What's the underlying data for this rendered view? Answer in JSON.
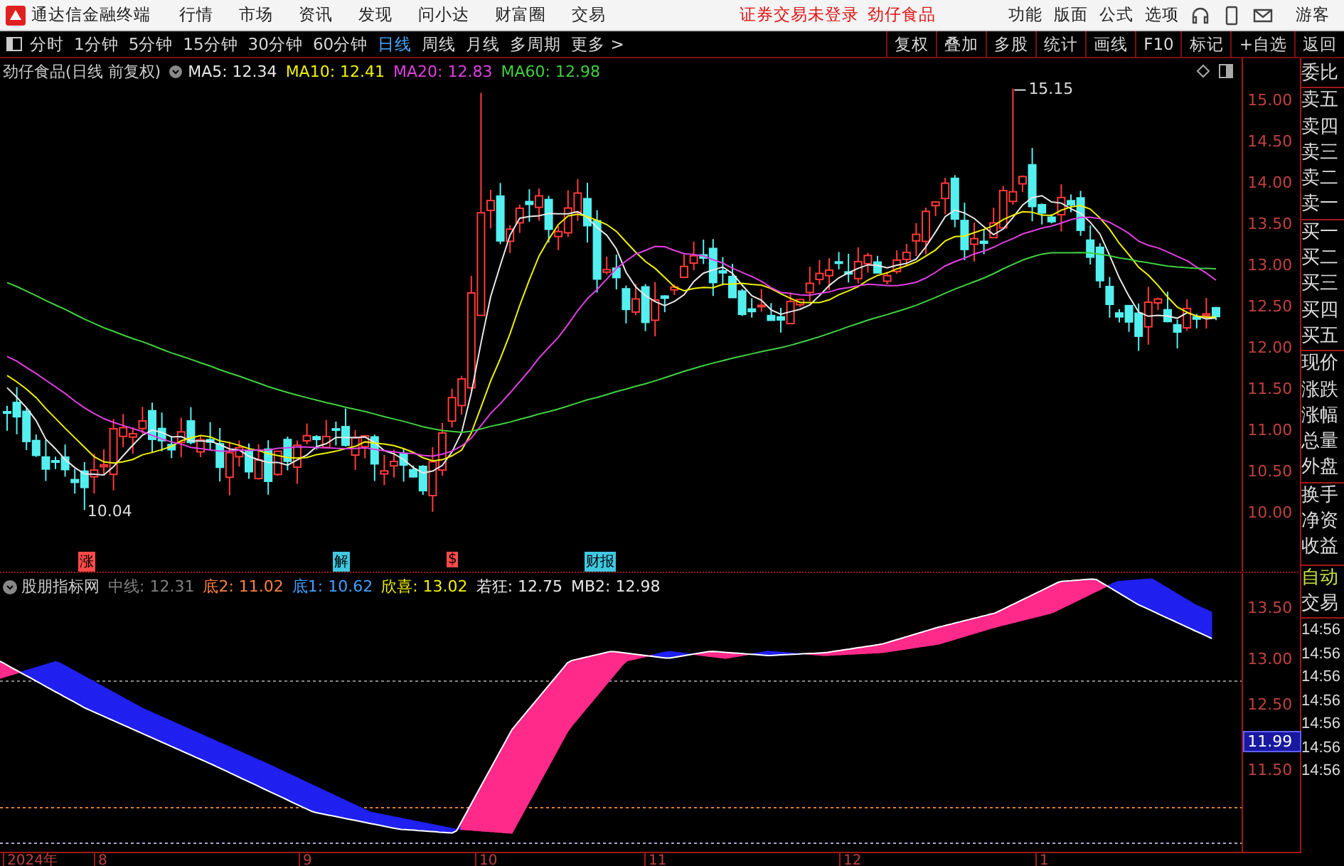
{
  "menubar": {
    "app_name": "通达信金融终端",
    "menus": [
      "行情",
      "市场",
      "资讯",
      "发现",
      "问小达",
      "财富圈",
      "交易"
    ],
    "notice": "证券交易未登录",
    "stock": "劲仔食品",
    "right_menus": [
      "功能",
      "版面",
      "公式",
      "选项"
    ],
    "user": "游客"
  },
  "periods": [
    {
      "label": "分时",
      "selected": false
    },
    {
      "label": "1分钟",
      "selected": false
    },
    {
      "label": "5分钟",
      "selected": false
    },
    {
      "label": "15分钟",
      "selected": false
    },
    {
      "label": "30分钟",
      "selected": false
    },
    {
      "label": "60分钟",
      "selected": false
    },
    {
      "label": "日线",
      "selected": true
    },
    {
      "label": "周线",
      "selected": false
    },
    {
      "label": "月线",
      "selected": false
    },
    {
      "label": "多周期",
      "selected": false
    },
    {
      "label": "更多 >",
      "selected": false
    }
  ],
  "tools": [
    "复权",
    "叠加",
    "多股",
    "统计",
    "画线",
    "F10",
    "标记",
    "+自选",
    "返回"
  ],
  "price_chart": {
    "title": "劲仔食品(日线 前复权)",
    "ma": [
      {
        "label": "MA5: 12.34",
        "color": "#e8e8e8"
      },
      {
        "label": "MA10: 12.41",
        "color": "#f0f000"
      },
      {
        "label": "MA20: 12.83",
        "color": "#e040e0"
      },
      {
        "label": "MA60: 12.98",
        "color": "#40d040"
      }
    ],
    "y_labels": [
      "15.00",
      "14.50",
      "14.00",
      "13.50",
      "13.00",
      "12.50",
      "12.00",
      "11.50",
      "11.00",
      "10.50",
      "10.00"
    ],
    "high_label": "15.15",
    "low_label": "10.04",
    "events": [
      {
        "label": "涨",
        "color": "#ff4a4a"
      },
      {
        "label": "解",
        "color": "#40c8e0"
      },
      {
        "label": "$",
        "color": "#ff4a4a"
      },
      {
        "label": "财报",
        "color": "#40c8e0"
      }
    ]
  },
  "indicator": {
    "name": "股朋指标网",
    "values": [
      {
        "label": "中线: 12.31",
        "color": "#808080"
      },
      {
        "label": "底2: 11.02",
        "color": "#ff8040"
      },
      {
        "label": "底1: 10.62",
        "color": "#40a0ff"
      },
      {
        "label": "欣喜: 13.02",
        "color": "#f0f000"
      },
      {
        "label": "若狂: 12.75",
        "color": "#e8e8e8"
      },
      {
        "label": "MB2: 12.98",
        "color": "#e8e8e8"
      }
    ],
    "y_labels": [
      "13.50",
      "13.00",
      "12.50",
      "11.50"
    ],
    "cursor_value": "11.99"
  },
  "quote_side": {
    "labels": [
      "委比",
      "卖五",
      "卖四",
      "卖三",
      "卖二",
      "卖一",
      "买一",
      "买二",
      "买三",
      "买四",
      "买五",
      "现价",
      "涨跌",
      "涨幅",
      "总量",
      "外盘",
      "换手",
      "净资",
      "收益"
    ],
    "mode": "自动",
    "trade_label": "交易",
    "times": [
      "14:56",
      "14:56",
      "14:56",
      "14:56",
      "14:56",
      "14:56",
      "14:56"
    ]
  },
  "time_axis": [
    "2024年",
    "8",
    "9",
    "10",
    "11",
    "12",
    "1"
  ]
}
